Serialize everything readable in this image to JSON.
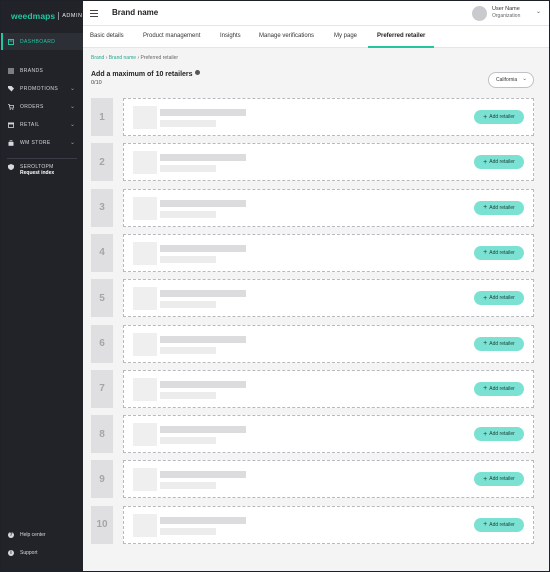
{
  "sidebar": {
    "logo_text": "weedmaps",
    "logo_badge": "ADMIN",
    "active_item": "DASHBOARD",
    "items": [
      {
        "label": "BRANDS",
        "icon": "list-icon",
        "has_chevron": false
      },
      {
        "label": "PROMOTIONS",
        "icon": "tag-icon",
        "has_chevron": true
      },
      {
        "label": "ORDERS",
        "icon": "cart-icon",
        "has_chevron": true
      },
      {
        "label": "RETAIL",
        "icon": "store-icon",
        "has_chevron": true
      },
      {
        "label": "WM STORE",
        "icon": "bag-icon",
        "has_chevron": true
      }
    ],
    "dropdown": {
      "line1": "SEROLTOPM",
      "line2": "Request index"
    },
    "bottom": [
      {
        "label": "Help center",
        "icon": "help-icon"
      },
      {
        "label": "Support",
        "icon": "info-icon"
      }
    ]
  },
  "topbar": {
    "brand_name": "Brand name",
    "user_name": "User Name",
    "user_org": "Organization"
  },
  "tabs": [
    {
      "label": "Basic details"
    },
    {
      "label": "Product management"
    },
    {
      "label": "Insights"
    },
    {
      "label": "Manage verifications"
    },
    {
      "label": "My page"
    },
    {
      "label": "Preferred retailer",
      "active": true
    }
  ],
  "breadcrumb": {
    "home": "Brand",
    "section": "Brand name",
    "current": "Preferred retailer"
  },
  "main": {
    "heading": "Add a maximum of 10 retailers",
    "counter": "0/10",
    "region_select": "California"
  },
  "retailers": {
    "button_label": "Add retailer",
    "slots": [
      "1",
      "2",
      "3",
      "4",
      "5",
      "6",
      "7",
      "8",
      "9",
      "10"
    ]
  },
  "colors": {
    "accent": "#23c6a0",
    "add_button": "#7be1d2",
    "sidebar_bg": "#212329"
  }
}
